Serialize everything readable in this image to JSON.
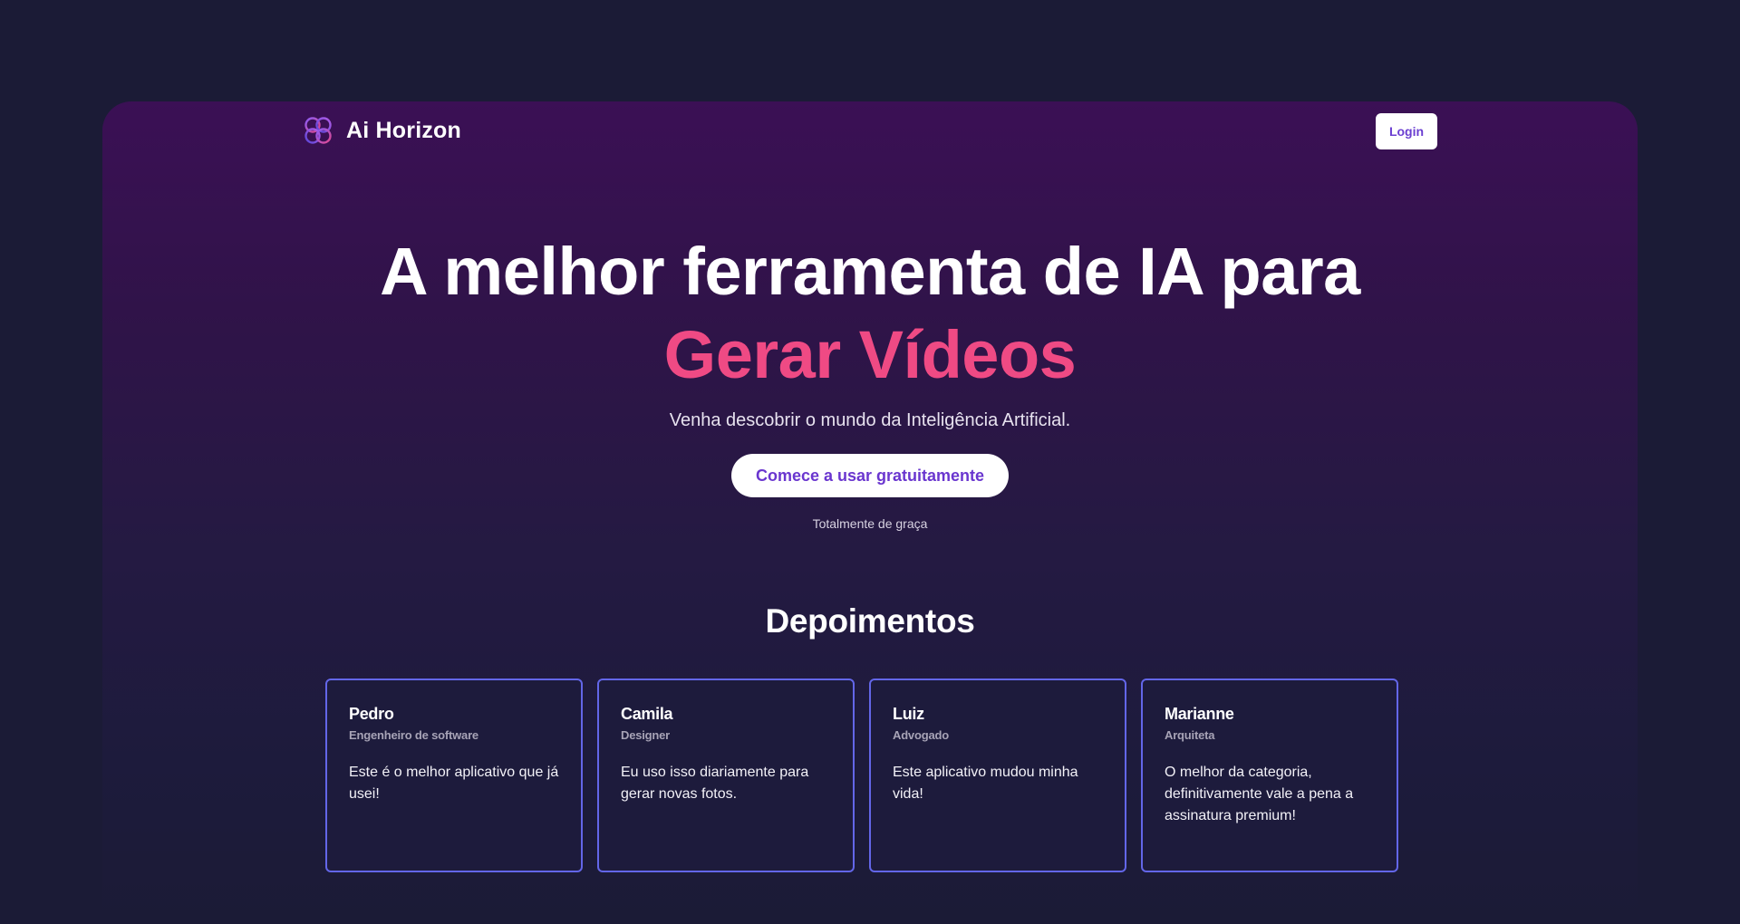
{
  "nav": {
    "brand": "Ai Horizon",
    "login_label": "Login"
  },
  "hero": {
    "headline": "A melhor ferramenta de IA para",
    "headline_accent": "Gerar Vídeos",
    "subtitle": "Venha descobrir o mundo da Inteligência Artificial.",
    "cta_label": "Comece a usar gratuitamente",
    "cta_note": "Totalmente de graça"
  },
  "testimonials": {
    "title": "Depoimentos",
    "items": [
      {
        "name": "Pedro",
        "role": "Engenheiro de software",
        "text": "Este é o melhor aplicativo que já usei!"
      },
      {
        "name": "Camila",
        "role": "Designer",
        "text": "Eu uso isso diariamente para gerar novas fotos."
      },
      {
        "name": "Luiz",
        "role": "Advogado",
        "text": "Este aplicativo mudou minha vida!"
      },
      {
        "name": "Marianne",
        "role": "Arquiteta",
        "text": "O melhor da categoria, definitivamente vale a pena a assinatura premium!"
      }
    ]
  },
  "colors": {
    "background": "#1b1b36",
    "hero_top": "#3b1055",
    "accent_pink": "#ef4a84",
    "button_text_purple": "#6a36cf",
    "card_border": "#6366e8"
  },
  "icons": {
    "logo": "ai-horizon-logo-icon"
  }
}
